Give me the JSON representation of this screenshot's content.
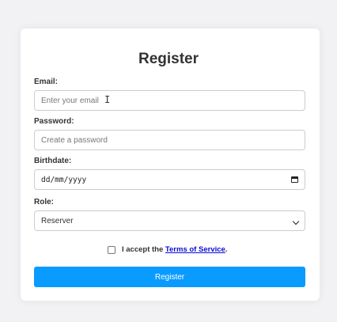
{
  "form": {
    "title": "Register",
    "email": {
      "label": "Email:",
      "placeholder": "Enter your email",
      "value": ""
    },
    "password": {
      "label": "Password:",
      "placeholder": "Create a password",
      "value": ""
    },
    "birthdate": {
      "label": "Birthdate:",
      "placeholder": "dd/mm/yyyy",
      "icon": "calendar-icon"
    },
    "role": {
      "label": "Role:",
      "selected": "Reserver",
      "icon": "chevron-down-icon"
    },
    "terms": {
      "prefix": "I accept the ",
      "link": "Terms of Service",
      "suffix": ".",
      "checked": false
    },
    "submit_label": "Register"
  },
  "colors": {
    "background": "#f2f1f4",
    "card": "#ffffff",
    "button": "#0a9bff",
    "link": "#0a0ad6"
  }
}
